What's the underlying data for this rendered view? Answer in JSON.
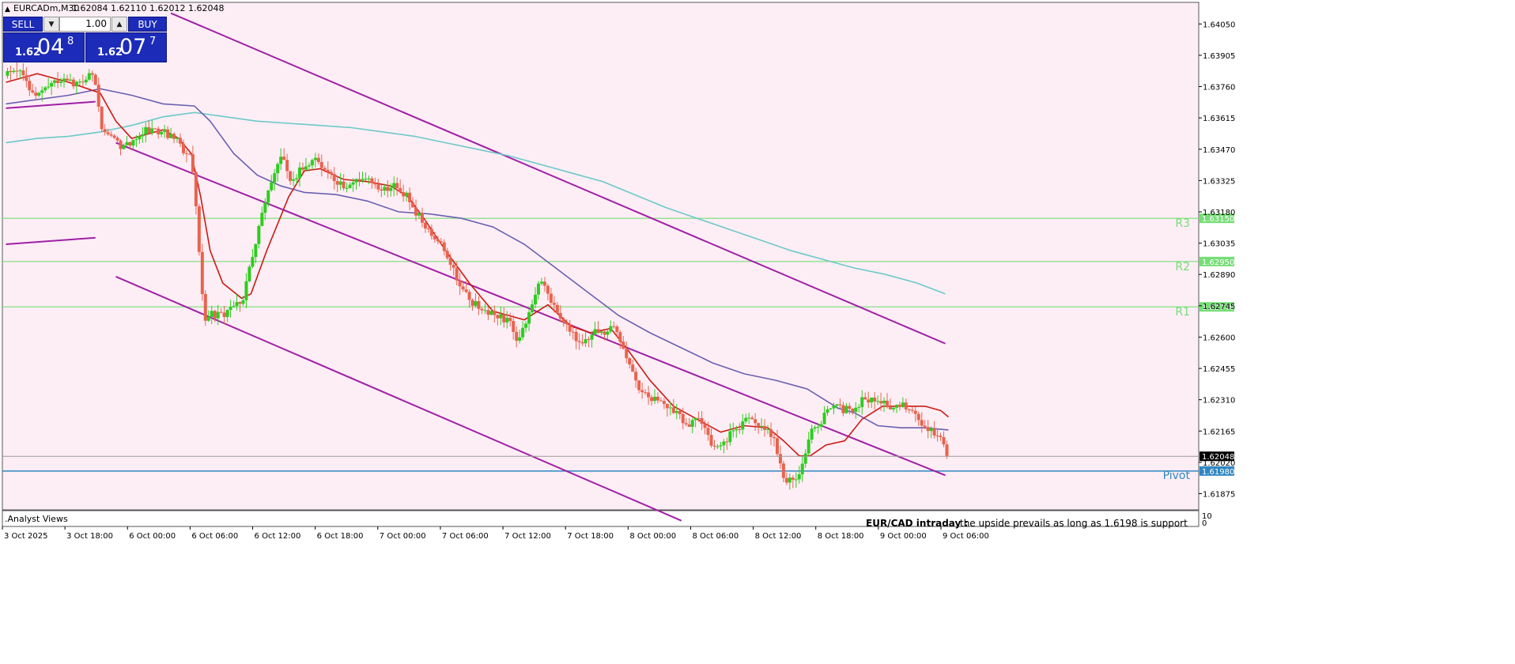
{
  "header": {
    "symbol": "EURCADm,M30",
    "ohlc": "1.62084 1.62110 1.62012 1.62048"
  },
  "trade_panel": {
    "sell_label": "SELL",
    "buy_label": "BUY",
    "lot": "1.00",
    "sell_small": "1.62",
    "sell_big": "04",
    "sell_sup": "8",
    "buy_small": "1.62",
    "buy_big": "07",
    "buy_sup": "7"
  },
  "indicator_window": {
    "title": ".Analyst Views",
    "note_title": "EUR/CAD intraday :",
    "note_text": "the upside prevails as long as 1.6198 is support",
    "scale_top": "10",
    "scale_bottom": "0"
  },
  "colors": {
    "background": "#fdeef5",
    "bull": "#2ecc1f",
    "bear": "#e8634f",
    "ma_fast": "#cc1a14",
    "ma_mid": "#6a5fb0",
    "ma_slow": "#6cc9c8",
    "channel": "#a01fa6",
    "pivot_level": "#77dd77",
    "pivot": "#2e86c1",
    "current_price": "#999999"
  },
  "chart_data": {
    "type": "candlestick",
    "y_range": [
      1.618,
      1.6415
    ],
    "y_ticks": [
      "1.64050",
      "1.63905",
      "1.63760",
      "1.63615",
      "1.63470",
      "1.63325",
      "1.63180",
      "1.63035",
      "1.62890",
      "1.62745",
      "1.62600",
      "1.62455",
      "1.62310",
      "1.62165",
      "1.62020",
      "1.61875"
    ],
    "x_ticks": [
      "3 Oct 2025",
      "3 Oct 18:00",
      "6 Oct 00:00",
      "6 Oct 06:00",
      "6 Oct 12:00",
      "6 Oct 18:00",
      "7 Oct 00:00",
      "7 Oct 06:00",
      "7 Oct 12:00",
      "7 Oct 18:00",
      "8 Oct 00:00",
      "8 Oct 06:00",
      "8 Oct 12:00",
      "8 Oct 18:00",
      "9 Oct 00:00",
      "9 Oct 06:00"
    ],
    "current_price": 1.62048,
    "current_price_label": "1.62048",
    "levels": [
      {
        "name": "R3",
        "value": 1.6315,
        "label": "1.63150"
      },
      {
        "name": "R2",
        "value": 1.6295,
        "label": "1.62950"
      },
      {
        "name": "R1",
        "value": 1.6274,
        "label": "1.62740"
      },
      {
        "name": "Pivot",
        "value": 1.6198,
        "label": "1.61980"
      }
    ],
    "channel_lines": [
      {
        "x1": 0,
        "y1": 1.6366,
        "x2": 57,
        "y2": 1.6369
      },
      {
        "x1": 0,
        "y1": 1.6303,
        "x2": 57,
        "y2": 1.6306
      },
      {
        "x1": 105,
        "y1": 1.641,
        "x2": 598,
        "y2": 1.6257
      },
      {
        "x1": 70,
        "y1": 1.635,
        "x2": 598,
        "y2": 1.6196
      },
      {
        "x1": 70,
        "y1": 1.6288,
        "x2": 430,
        "y2": 1.6175
      }
    ],
    "anchors": [
      [
        0,
        1.6381
      ],
      [
        8,
        1.6385
      ],
      [
        14,
        1.6375
      ],
      [
        20,
        1.6372
      ],
      [
        27,
        1.6378
      ],
      [
        37,
        1.6378
      ],
      [
        45,
        1.6377
      ],
      [
        53,
        1.6382
      ],
      [
        57,
        1.6378
      ],
      [
        61,
        1.6358
      ],
      [
        66,
        1.6355
      ],
      [
        69,
        1.6353
      ],
      [
        74,
        1.6348
      ],
      [
        80,
        1.6351
      ],
      [
        90,
        1.6356
      ],
      [
        100,
        1.6355
      ],
      [
        110,
        1.635
      ],
      [
        118,
        1.6342
      ],
      [
        122,
        1.6312
      ],
      [
        126,
        1.6268
      ],
      [
        130,
        1.6271
      ],
      [
        138,
        1.627
      ],
      [
        150,
        1.6276
      ],
      [
        158,
        1.63
      ],
      [
        162,
        1.6315
      ],
      [
        166,
        1.6325
      ],
      [
        171,
        1.6335
      ],
      [
        176,
        1.6345
      ],
      [
        182,
        1.633
      ],
      [
        186,
        1.6337
      ],
      [
        192,
        1.6341
      ],
      [
        198,
        1.6342
      ],
      [
        203,
        1.6338
      ],
      [
        208,
        1.6333
      ],
      [
        215,
        1.633
      ],
      [
        222,
        1.6332
      ],
      [
        230,
        1.6334
      ],
      [
        238,
        1.6328
      ],
      [
        246,
        1.633
      ],
      [
        253,
        1.6327
      ],
      [
        258,
        1.6322
      ],
      [
        265,
        1.6313
      ],
      [
        272,
        1.6307
      ],
      [
        280,
        1.63
      ],
      [
        288,
        1.6285
      ],
      [
        296,
        1.6277
      ],
      [
        304,
        1.6272
      ],
      [
        310,
        1.627
      ],
      [
        318,
        1.6268
      ],
      [
        322,
        1.6265
      ],
      [
        326,
        1.6257
      ],
      [
        330,
        1.6265
      ],
      [
        336,
        1.6275
      ],
      [
        340,
        1.6286
      ],
      [
        345,
        1.628
      ],
      [
        352,
        1.627
      ],
      [
        357,
        1.6265
      ],
      [
        362,
        1.626
      ],
      [
        369,
        1.6258
      ],
      [
        375,
        1.6262
      ],
      [
        381,
        1.6263
      ],
      [
        386,
        1.6264
      ],
      [
        392,
        1.6258
      ],
      [
        398,
        1.6245
      ],
      [
        403,
        1.6235
      ],
      [
        410,
        1.6232
      ],
      [
        418,
        1.6229
      ],
      [
        426,
        1.6225
      ],
      [
        434,
        1.622
      ],
      [
        440,
        1.6222
      ],
      [
        445,
        1.6216
      ],
      [
        452,
        1.6208
      ],
      [
        458,
        1.6212
      ],
      [
        465,
        1.6218
      ],
      [
        472,
        1.6222
      ],
      [
        480,
        1.6218
      ],
      [
        486,
        1.6216
      ],
      [
        490,
        1.621
      ],
      [
        496,
        1.6192
      ],
      [
        502,
        1.6194
      ],
      [
        507,
        1.62
      ],
      [
        510,
        1.621
      ],
      [
        514,
        1.6218
      ],
      [
        520,
        1.6222
      ],
      [
        524,
        1.6228
      ],
      [
        530,
        1.6227
      ],
      [
        536,
        1.6226
      ],
      [
        541,
        1.6228
      ],
      [
        546,
        1.6232
      ],
      [
        551,
        1.623
      ],
      [
        556,
        1.623
      ],
      [
        562,
        1.6228
      ],
      [
        568,
        1.6229
      ],
      [
        574,
        1.6227
      ],
      [
        580,
        1.6223
      ],
      [
        586,
        1.6218
      ],
      [
        590,
        1.6215
      ],
      [
        595,
        1.6212
      ],
      [
        598,
        1.6207
      ],
      [
        600,
        1.62048
      ]
    ],
    "ma_fast": [
      [
        0,
        1.6378
      ],
      [
        20,
        1.6382
      ],
      [
        40,
        1.6378
      ],
      [
        60,
        1.6373
      ],
      [
        70,
        1.636
      ],
      [
        80,
        1.6352
      ],
      [
        100,
        1.6356
      ],
      [
        110,
        1.6352
      ],
      [
        118,
        1.6345
      ],
      [
        124,
        1.6325
      ],
      [
        130,
        1.63
      ],
      [
        138,
        1.6285
      ],
      [
        150,
        1.6278
      ],
      [
        156,
        1.628
      ],
      [
        166,
        1.63
      ],
      [
        180,
        1.6325
      ],
      [
        190,
        1.6337
      ],
      [
        200,
        1.6338
      ],
      [
        215,
        1.6333
      ],
      [
        230,
        1.6332
      ],
      [
        245,
        1.633
      ],
      [
        256,
        1.6325
      ],
      [
        266,
        1.6315
      ],
      [
        280,
        1.63
      ],
      [
        295,
        1.6285
      ],
      [
        310,
        1.6272
      ],
      [
        320,
        1.627
      ],
      [
        330,
        1.6268
      ],
      [
        345,
        1.6275
      ],
      [
        360,
        1.6265
      ],
      [
        372,
        1.6262
      ],
      [
        385,
        1.6264
      ],
      [
        395,
        1.6255
      ],
      [
        410,
        1.624
      ],
      [
        425,
        1.6228
      ],
      [
        440,
        1.6222
      ],
      [
        455,
        1.6216
      ],
      [
        470,
        1.6219
      ],
      [
        485,
        1.6218
      ],
      [
        495,
        1.6212
      ],
      [
        505,
        1.6205
      ],
      [
        512,
        1.6205
      ],
      [
        522,
        1.621
      ],
      [
        534,
        1.6212
      ],
      [
        545,
        1.6222
      ],
      [
        558,
        1.6228
      ],
      [
        570,
        1.6228
      ],
      [
        585,
        1.6228
      ],
      [
        595,
        1.6226
      ],
      [
        600,
        1.6223
      ]
    ],
    "ma_mid": [
      [
        0,
        1.6368
      ],
      [
        20,
        1.637
      ],
      [
        40,
        1.6372
      ],
      [
        60,
        1.6375
      ],
      [
        80,
        1.6372
      ],
      [
        100,
        1.6368
      ],
      [
        120,
        1.6367
      ],
      [
        130,
        1.636
      ],
      [
        145,
        1.6345
      ],
      [
        160,
        1.6335
      ],
      [
        175,
        1.633
      ],
      [
        190,
        1.6327
      ],
      [
        210,
        1.6326
      ],
      [
        230,
        1.6323
      ],
      [
        250,
        1.6318
      ],
      [
        270,
        1.6317
      ],
      [
        290,
        1.6315
      ],
      [
        310,
        1.6311
      ],
      [
        330,
        1.6303
      ],
      [
        350,
        1.6292
      ],
      [
        370,
        1.6281
      ],
      [
        390,
        1.627
      ],
      [
        410,
        1.6262
      ],
      [
        430,
        1.6255
      ],
      [
        450,
        1.6248
      ],
      [
        470,
        1.6243
      ],
      [
        490,
        1.624
      ],
      [
        510,
        1.6236
      ],
      [
        530,
        1.6227
      ],
      [
        540,
        1.6225
      ],
      [
        555,
        1.6219
      ],
      [
        570,
        1.6218
      ],
      [
        585,
        1.6218
      ],
      [
        600,
        1.6217
      ]
    ],
    "ma_slow": [
      [
        0,
        1.635
      ],
      [
        20,
        1.6352
      ],
      [
        40,
        1.6353
      ],
      [
        60,
        1.6355
      ],
      [
        80,
        1.6358
      ],
      [
        100,
        1.6362
      ],
      [
        120,
        1.6364
      ],
      [
        140,
        1.6362
      ],
      [
        160,
        1.636
      ],
      [
        180,
        1.6359
      ],
      [
        200,
        1.6358
      ],
      [
        220,
        1.6357
      ],
      [
        240,
        1.6355
      ],
      [
        260,
        1.6353
      ],
      [
        280,
        1.635
      ],
      [
        300,
        1.6347
      ],
      [
        320,
        1.6344
      ],
      [
        340,
        1.634
      ],
      [
        360,
        1.6336
      ],
      [
        380,
        1.6332
      ],
      [
        400,
        1.6326
      ],
      [
        420,
        1.632
      ],
      [
        440,
        1.6315
      ],
      [
        460,
        1.631
      ],
      [
        480,
        1.6305
      ],
      [
        500,
        1.63
      ],
      [
        520,
        1.6296
      ],
      [
        540,
        1.6292
      ],
      [
        560,
        1.6289
      ],
      [
        580,
        1.6285
      ],
      [
        598,
        1.628
      ]
    ]
  }
}
